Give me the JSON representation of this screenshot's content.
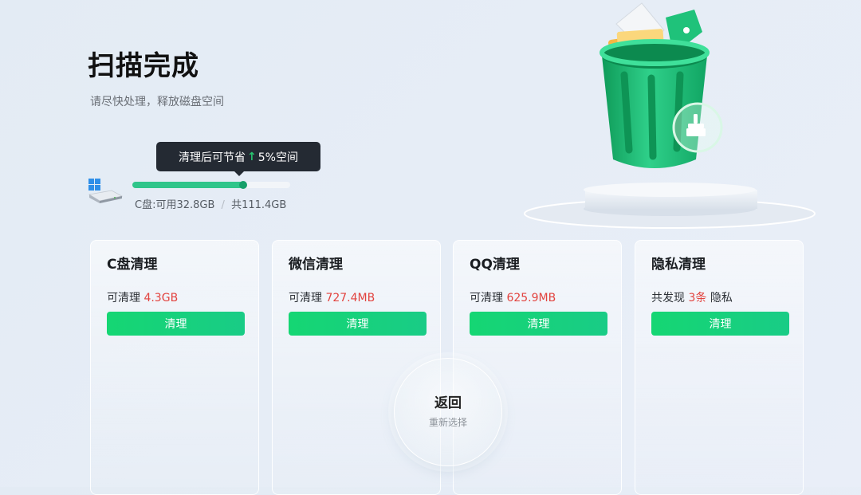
{
  "header": {
    "title": "扫描完成",
    "subtitle": "请尽快处理，释放磁盘空间"
  },
  "tooltip": {
    "prefix": "清理后可节省",
    "arrow": "↑",
    "value": "5%空间"
  },
  "disk": {
    "available": "C盘:可用32.8GB",
    "separator": "/",
    "total": "共111.4GB",
    "used_fraction": 0.7
  },
  "cards": [
    {
      "title": "C盘清理",
      "prefix": "可清理 ",
      "value": "4.3GB",
      "suffix": "",
      "button": "清理"
    },
    {
      "title": "微信清理",
      "prefix": "可清理 ",
      "value": "727.4MB",
      "suffix": "",
      "button": "清理"
    },
    {
      "title": "QQ清理",
      "prefix": "可清理 ",
      "value": "625.9MB",
      "suffix": "",
      "button": "清理"
    },
    {
      "title": "隐私清理",
      "prefix": "共发现 ",
      "value": "3条",
      "suffix": " 隐私",
      "button": "清理"
    }
  ],
  "back": {
    "title": "返回",
    "subtitle": "重新选择"
  },
  "colors": {
    "accent_green": "#15d673",
    "highlight_red": "#e2433f",
    "tooltip_bg": "#242a33"
  },
  "icons": {
    "drive": "windows-drive-icon",
    "illustration": "trash-bin-icon",
    "broom": "broom-icon"
  }
}
